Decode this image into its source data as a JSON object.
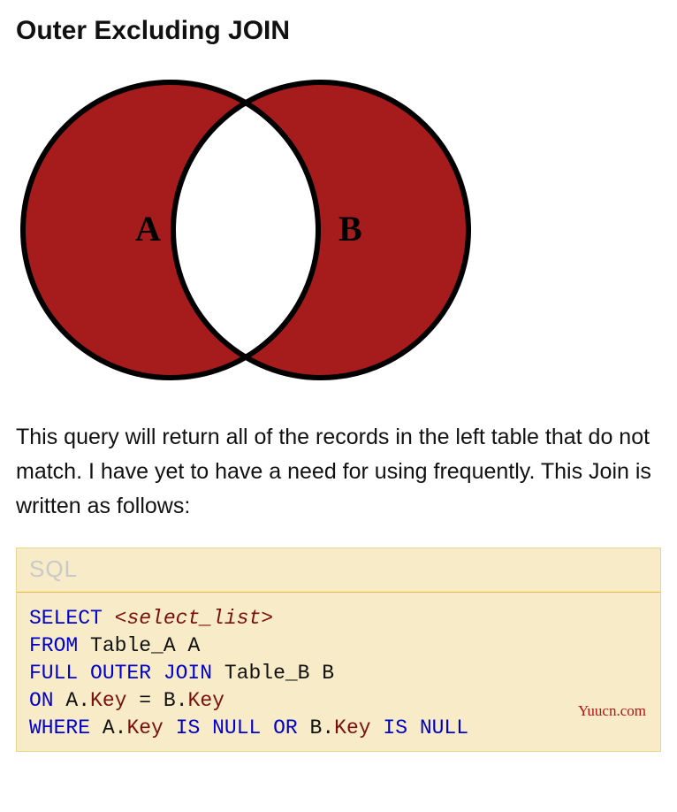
{
  "title": "Outer Excluding JOIN",
  "venn": {
    "labelA": "A",
    "labelB": "B"
  },
  "description": "This query will return all of the records in the left table that do not match. I have yet to have a need for using frequently. This Join is written as follows:",
  "code": {
    "label": "SQL",
    "tokens": {
      "select": "SELECT",
      "selectList": "<select_list>",
      "from": "FROM",
      "tableA": "Table_A A",
      "fullOuterJoin": "FULL OUTER JOIN",
      "tableB": "Table_B B",
      "on": "ON",
      "aPrefix1": "A",
      "dot": ".",
      "key1": "Key",
      "eq": " = ",
      "bPrefix1": "B",
      "key2": "Key",
      "where": "WHERE",
      "aPrefix2": "A",
      "key3": "Key",
      "isNull1": "IS NULL",
      "or": "OR",
      "bPrefix2": "B",
      "key4": "Key",
      "isNull2": "IS NULL"
    }
  },
  "watermark": "Yuucn.com"
}
